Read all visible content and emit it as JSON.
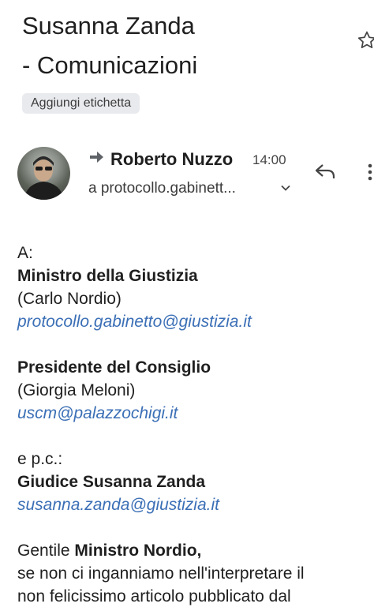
{
  "email": {
    "subject_line1": "Susanna Zanda",
    "subject_line2": "- Comunicazioni",
    "label_button": "Aggiungi etichetta",
    "sender_name": "Roberto Nuzzo",
    "time": "14:00",
    "recipient": "a protocollo.gabinett..."
  },
  "body": {
    "to_label": "A:",
    "r1_title": "Ministro della Giustizia",
    "r1_name": "(Carlo Nordio)",
    "r1_email": "protocollo.gabinetto@giustizia.it",
    "r2_title": "Presidente del Consiglio",
    "r2_name": "(Giorgia Meloni)",
    "r2_email": "uscm@palazzochigi.it",
    "cc_label": "e p.c.:",
    "cc_title": "Giudice Susanna Zanda",
    "cc_email": "susanna.zanda@giustizia.it",
    "greeting_prefix": "Gentile",
    "greeting_name": "Ministro Nordio,",
    "line1": "se non ci inganniamo nell'interpretare il",
    "line2": "non felicissimo articolo pubblicato dal"
  },
  "icons": {
    "star": "star-outline-icon",
    "forward": "forward-arrow-icon",
    "reply": "reply-icon",
    "more": "more-vert-icon",
    "chevron": "chevron-down-icon"
  },
  "colors": {
    "link": "#3b6fb6",
    "chip_bg": "#e9eaee"
  }
}
